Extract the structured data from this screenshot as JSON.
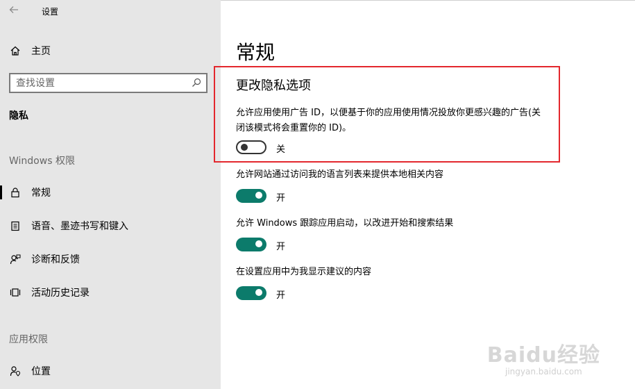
{
  "window": {
    "title": "设置"
  },
  "sidebar": {
    "home_label": "主页",
    "search_placeholder": "查找设置",
    "category_label": "隐私",
    "windows_permissions_heading": "Windows 权限",
    "items": [
      {
        "label": "常规",
        "icon": "lock-icon",
        "selected": true
      },
      {
        "label": "语音、墨迹书写和键入",
        "icon": "clipboard-icon",
        "selected": false
      },
      {
        "label": "诊断和反馈",
        "icon": "feedback-person-icon",
        "selected": false
      },
      {
        "label": "活动历史记录",
        "icon": "timeline-icon",
        "selected": false
      }
    ],
    "app_permissions_heading": "应用权限",
    "app_items": [
      {
        "label": "位置",
        "icon": "location-person-icon"
      }
    ]
  },
  "main": {
    "page_title": "常规",
    "section_title": "更改隐私选项",
    "settings": [
      {
        "description": "允许应用使用广告 ID，以便基于你的应用使用情况投放你更感兴趣的广告(关闭该模式将会重置你的 ID)。",
        "state": "off",
        "state_label": "关"
      },
      {
        "description": "允许网站通过访问我的语言列表来提供本地相关内容",
        "state": "on",
        "state_label": "开"
      },
      {
        "description": "允许 Windows 跟踪应用启动，以改进开始和搜索结果",
        "state": "on",
        "state_label": "开"
      },
      {
        "description": "在设置应用中为我显示建议的内容",
        "state": "on",
        "state_label": "开"
      }
    ]
  },
  "watermark": {
    "main": "Baidu经验",
    "sub": "jingyan.baidu.com"
  },
  "colors": {
    "accent": "#0c7b6b",
    "highlight_border": "#e3272d",
    "sidebar_bg": "#e6e6e6"
  }
}
